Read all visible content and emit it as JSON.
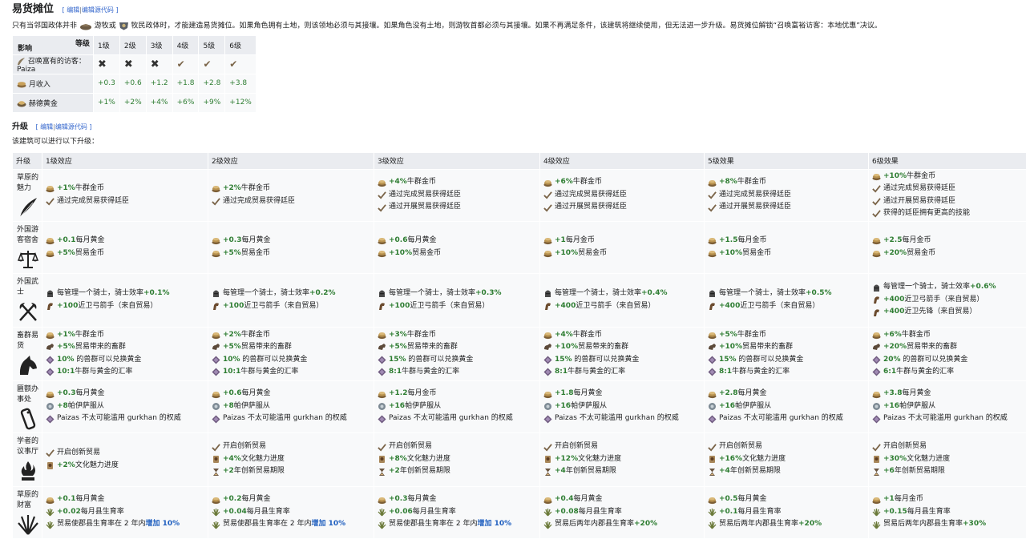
{
  "title": "易货摊位",
  "edit_links": {
    "edit": "编辑",
    "sep": "|",
    "edit_source": "编辑源代码"
  },
  "intro": {
    "p1": "只有当邻国政体并非",
    "gov1": "游牧或",
    "gov2": "牧民政体时，才能建造易货摊位。如果角色拥有土地，则该领地必须与其接壤。如果角色没有土地，则游牧首都必须与其接壤。如果不再满足条件，该建筑将继续使用，但无法进一步升级。易货摊位解锁“召唤富裕访客：本地优惠”决议。"
  },
  "small_table": {
    "corner_top": "等级",
    "corner_bottom": "影响",
    "levels": [
      "1级",
      "2级",
      "3级",
      "4级",
      "5级",
      "6级"
    ],
    "rows": [
      {
        "label": "召唤富有的访客：Paiza",
        "icon": "horn-icon",
        "cells": [
          "✖",
          "✖",
          "✖",
          "✔",
          "✔",
          "✔"
        ]
      },
      {
        "label": "月收入",
        "icon": "coins-icon",
        "cells": [
          "+0.3",
          "+0.6",
          "+1.2",
          "+1.8",
          "+2.8",
          "+3.8"
        ]
      },
      {
        "label": "赫德黄金",
        "icon": "gold-icon",
        "cells": [
          "+1%",
          "+2%",
          "+4%",
          "+6%",
          "+9%",
          "+12%"
        ]
      }
    ]
  },
  "upgrades": {
    "title": "升级",
    "sub": "该建筑可以进行以下升级：",
    "headers": [
      "升级",
      "1级效应",
      "2级效应",
      "3级效应",
      "4级效应",
      "5级效果",
      "6级效果"
    ],
    "rows": [
      {
        "name": "草原的魅力",
        "icon": "feather-icon",
        "cells": [
          [
            {
              "i": "coins",
              "v": "+1%",
              "t": "牛群金币"
            },
            {
              "i": "check",
              "t": "通过完成贸易获得廷臣"
            }
          ],
          [
            {
              "i": "coins",
              "v": "+2%",
              "t": "牛群金币"
            },
            {
              "i": "check",
              "t": "通过完成贸易获得廷臣"
            }
          ],
          [
            {
              "i": "coins",
              "v": "+4%",
              "t": "牛群金币"
            },
            {
              "i": "check",
              "t": "通过完成贸易获得廷臣"
            },
            {
              "i": "check",
              "t": "通过开展贸易获得廷臣"
            }
          ],
          [
            {
              "i": "coins",
              "v": "+6%",
              "t": "牛群金币"
            },
            {
              "i": "check",
              "t": "通过完成贸易获得廷臣"
            },
            {
              "i": "check",
              "t": "通过开展贸易获得廷臣"
            }
          ],
          [
            {
              "i": "coins",
              "v": "+8%",
              "t": "牛群金币"
            },
            {
              "i": "check",
              "t": "通过完成贸易获得廷臣"
            },
            {
              "i": "check",
              "t": "通过开展贸易获得廷臣"
            }
          ],
          [
            {
              "i": "coins",
              "v": "+10%",
              "t": "牛群金币"
            },
            {
              "i": "check",
              "t": "通过完成贸易获得廷臣"
            },
            {
              "i": "check",
              "t": "通过开展贸易获得廷臣"
            },
            {
              "i": "check",
              "t": "获得的廷臣拥有更高的技能"
            }
          ]
        ]
      },
      {
        "name": "外国游客宿舍",
        "icon": "scales-icon",
        "cells": [
          [
            {
              "i": "coins",
              "v": "+0.1",
              "t": "每月黄金"
            },
            {
              "i": "coins",
              "v": "+5%",
              "t": "贸易金币"
            }
          ],
          [
            {
              "i": "coins",
              "v": "+0.3",
              "t": "每月黄金"
            },
            {
              "i": "coins",
              "v": "+5%",
              "t": "贸易金币"
            }
          ],
          [
            {
              "i": "coins",
              "v": "+0.6",
              "t": "每月黄金"
            },
            {
              "i": "coins",
              "v": "+10%",
              "t": "贸易金币"
            }
          ],
          [
            {
              "i": "coins",
              "v": "+1",
              "t": "每月金币"
            },
            {
              "i": "coins",
              "v": "+10%",
              "t": "贸易金币"
            }
          ],
          [
            {
              "i": "coins",
              "v": "+1.5",
              "t": "每月金币"
            },
            {
              "i": "coins",
              "v": "+10%",
              "t": "贸易金币"
            }
          ],
          [
            {
              "i": "coins",
              "v": "+2.5",
              "t": "每月金币"
            },
            {
              "i": "coins",
              "v": "+20%",
              "t": "贸易金币"
            }
          ]
        ]
      },
      {
        "name": "外国武士",
        "icon": "axes-icon",
        "cells": [
          [
            {
              "i": "helm",
              "t": "每管理一个骑士，骑士效率",
              "v2": "+0.1%"
            },
            {
              "i": "horse",
              "v": "+100",
              "t": "近卫弓箭手（来自贸易）"
            }
          ],
          [
            {
              "i": "helm",
              "t": "每管理一个骑士，骑士效率",
              "v2": "+0.2%"
            },
            {
              "i": "horse",
              "v": "+100",
              "t": "近卫弓箭手（来自贸易）"
            }
          ],
          [
            {
              "i": "helm",
              "t": "每管理一个骑士，骑士效率",
              "v2": "+0.3%"
            },
            {
              "i": "horse",
              "v": "+100",
              "t": "近卫弓箭手（来自贸易）"
            }
          ],
          [
            {
              "i": "helm",
              "t": "每管理一个骑士，骑士效率",
              "v2": "+0.4%"
            },
            {
              "i": "horse",
              "v": "+400",
              "t": "近卫弓箭手（来自贸易）"
            }
          ],
          [
            {
              "i": "helm",
              "t": "每管理一个骑士，骑士效率",
              "v2": "+0.5%"
            },
            {
              "i": "horse",
              "v": "+400",
              "t": "近卫弓箭手（来自贸易）"
            }
          ],
          [
            {
              "i": "helm",
              "t": "每管理一个骑士，骑士效率",
              "v2": "+0.6%"
            },
            {
              "i": "horse",
              "v": "+400",
              "t": "近卫弓箭手（来自贸易）"
            },
            {
              "i": "horse",
              "v": "+400",
              "t": "近卫先锋（来自贸易）"
            }
          ]
        ]
      },
      {
        "name": "畜群易货",
        "icon": "horse-head-icon",
        "cells": [
          [
            {
              "i": "coins",
              "v": "+1%",
              "t": "牛群金币"
            },
            {
              "i": "herd",
              "v": "+5%",
              "t": "贸易带来的畜群"
            },
            {
              "i": "gem",
              "v": "10%",
              "t": " 的兽群可以兑换黄金"
            },
            {
              "i": "gem",
              "v": "10:1",
              "t": "牛群与黄金的汇率"
            }
          ],
          [
            {
              "i": "coins",
              "v": "+2%",
              "t": "牛群金币"
            },
            {
              "i": "herd",
              "v": "+5%",
              "t": "贸易带来的畜群"
            },
            {
              "i": "gem",
              "v": "10%",
              "t": " 的兽群可以兑换黄金"
            },
            {
              "i": "gem",
              "v": "10:1",
              "t": "牛群与黄金的汇率"
            }
          ],
          [
            {
              "i": "coins",
              "v": "+3%",
              "t": "牛群金币"
            },
            {
              "i": "herd",
              "v": "+5%",
              "t": "贸易带来的畜群"
            },
            {
              "i": "gem",
              "v": "15%",
              "t": " 的兽群可以兑换黄金"
            },
            {
              "i": "gem",
              "v": "8:1",
              "t": "牛群与黄金的汇率"
            }
          ],
          [
            {
              "i": "coins",
              "v": "+4%",
              "t": "牛群金币"
            },
            {
              "i": "herd",
              "v": "+10%",
              "t": "贸易带来的畜群"
            },
            {
              "i": "gem",
              "v": "15%",
              "t": " 的兽群可以兑换黄金"
            },
            {
              "i": "gem",
              "v": "8:1",
              "t": "牛群与黄金的汇率"
            }
          ],
          [
            {
              "i": "coins",
              "v": "+5%",
              "t": "牛群金币"
            },
            {
              "i": "herd",
              "v": "+10%",
              "t": "贸易带来的畜群"
            },
            {
              "i": "gem",
              "v": "15%",
              "t": " 的兽群可以兑换黄金"
            },
            {
              "i": "gem",
              "v": "8:1",
              "t": "牛群与黄金的汇率"
            }
          ],
          [
            {
              "i": "coins",
              "v": "+6%",
              "t": "牛群金币"
            },
            {
              "i": "herd",
              "v": "+20%",
              "t": "贸易带来的畜群"
            },
            {
              "i": "gem",
              "v": "20%",
              "t": " 的兽群可以兑换黄金"
            },
            {
              "i": "gem",
              "v": "6:1",
              "t": "牛群与黄金的汇率"
            }
          ]
        ]
      },
      {
        "name": "匾额办事处",
        "icon": "tablet-icon",
        "cells": [
          [
            {
              "i": "coins",
              "v": "+0.3",
              "t": "每月黄金"
            },
            {
              "i": "troop",
              "v": "+8",
              "t": "帕伊萨服从"
            },
            {
              "i": "gem",
              "t": "Paizas 不太可能滥用 gurkhan 的权威"
            }
          ],
          [
            {
              "i": "coins",
              "v": "+0.6",
              "t": "每月黄金"
            },
            {
              "i": "troop",
              "v": "+8",
              "t": "帕伊萨服从"
            },
            {
              "i": "gem",
              "t": "Paizas 不太可能滥用 gurkhan 的权威"
            }
          ],
          [
            {
              "i": "coins",
              "v": "+1.2",
              "t": "每月金币"
            },
            {
              "i": "troop",
              "v": "+16",
              "t": "帕伊萨服从"
            },
            {
              "i": "gem",
              "t": "Paizas 不太可能滥用 gurkhan 的权威"
            }
          ],
          [
            {
              "i": "coins",
              "v": "+1.8",
              "t": "每月黄金"
            },
            {
              "i": "troop",
              "v": "+16",
              "t": "帕伊萨服从"
            },
            {
              "i": "gem",
              "t": "Paizas 不太可能滥用 gurkhan 的权威"
            }
          ],
          [
            {
              "i": "coins",
              "v": "+2.8",
              "t": "每月黄金"
            },
            {
              "i": "troop",
              "v": "+16",
              "t": "帕伊萨服从"
            },
            {
              "i": "gem",
              "t": "Paizas 不太可能滥用 gurkhan 的权威"
            }
          ],
          [
            {
              "i": "coins",
              "v": "+3.8",
              "t": "每月黄金"
            },
            {
              "i": "troop",
              "v": "+16",
              "t": "帕伊萨服从"
            },
            {
              "i": "gem",
              "t": "Paizas 不太可能滥用 gurkhan 的权威"
            }
          ]
        ]
      },
      {
        "name": "学者的议事厅",
        "icon": "flame-icon",
        "cells": [
          [
            {
              "i": "check",
              "t": "开启创新贸易"
            },
            {
              "i": "scroll",
              "v": "+2%",
              "t": "文化魅力进度"
            }
          ],
          [
            {
              "i": "check",
              "t": "开启创新贸易"
            },
            {
              "i": "scroll",
              "v": "+4%",
              "t": "文化魅力进度"
            },
            {
              "i": "hourglass",
              "v": "+2",
              "t": "年创新贸易期限"
            }
          ],
          [
            {
              "i": "check",
              "t": "开启创新贸易"
            },
            {
              "i": "scroll",
              "v": "+8%",
              "t": "文化魅力进度"
            },
            {
              "i": "hourglass",
              "v": "+2",
              "t": "年创新贸易期限"
            }
          ],
          [
            {
              "i": "check",
              "t": "开启创新贸易"
            },
            {
              "i": "scroll",
              "v": "+12%",
              "t": "文化魅力进度"
            },
            {
              "i": "hourglass",
              "v": "+4",
              "t": "年创新贸易期限"
            }
          ],
          [
            {
              "i": "check",
              "t": "开启创新贸易"
            },
            {
              "i": "scroll",
              "v": "+16%",
              "t": "文化魅力进度"
            },
            {
              "i": "hourglass",
              "v": "+4",
              "t": "年创新贸易期限"
            }
          ],
          [
            {
              "i": "check",
              "t": "开启创新贸易"
            },
            {
              "i": "scroll",
              "v": "+30%",
              "t": "文化魅力进度"
            },
            {
              "i": "hourglass",
              "v": "+6",
              "t": "年创新贸易期限"
            }
          ]
        ]
      },
      {
        "name": "草原的财富",
        "icon": "grass-icon",
        "cells": [
          [
            {
              "i": "coins",
              "v": "+0.1",
              "t": "每月黄金"
            },
            {
              "i": "grass",
              "v": "+0.02",
              "t": "每月县生育率"
            },
            {
              "i": "grass",
              "t": "贸易使郡县生育率在 2 年内",
              "b": "增加 10%"
            }
          ],
          [
            {
              "i": "coins",
              "v": "+0.2",
              "t": "每月黄金"
            },
            {
              "i": "grass",
              "v": "+0.04",
              "t": "每月县生育率"
            },
            {
              "i": "grass",
              "t": "贸易使郡县生育率在 2 年内",
              "b": "增加 10%"
            }
          ],
          [
            {
              "i": "coins",
              "v": "+0.3",
              "t": "每月黄金"
            },
            {
              "i": "grass",
              "v": "+0.06",
              "t": "每月县生育率"
            },
            {
              "i": "grass",
              "t": "贸易使郡县生育率在 2 年内",
              "b": "增加 10%"
            }
          ],
          [
            {
              "i": "coins",
              "v": "+0.4",
              "t": "每月黄金"
            },
            {
              "i": "grass",
              "v": "+0.08",
              "t": "每月县生育率"
            },
            {
              "i": "grass",
              "t": "贸易后两年内郡县生育率",
              "v2": "+20%"
            }
          ],
          [
            {
              "i": "coins",
              "v": "+0.5",
              "t": "每月黄金"
            },
            {
              "i": "grass",
              "v": "+0.1",
              "t": "每月县生育率"
            },
            {
              "i": "grass",
              "t": "贸易后两年内郡县生育率",
              "v2": "+20%"
            }
          ],
          [
            {
              "i": "coins",
              "v": "+1",
              "t": "每月金币"
            },
            {
              "i": "grass",
              "v": "+0.15",
              "t": "每月县生育率"
            },
            {
              "i": "grass",
              "t": "贸易后两年内郡县生育率",
              "v2": "+30%"
            }
          ]
        ]
      }
    ]
  }
}
